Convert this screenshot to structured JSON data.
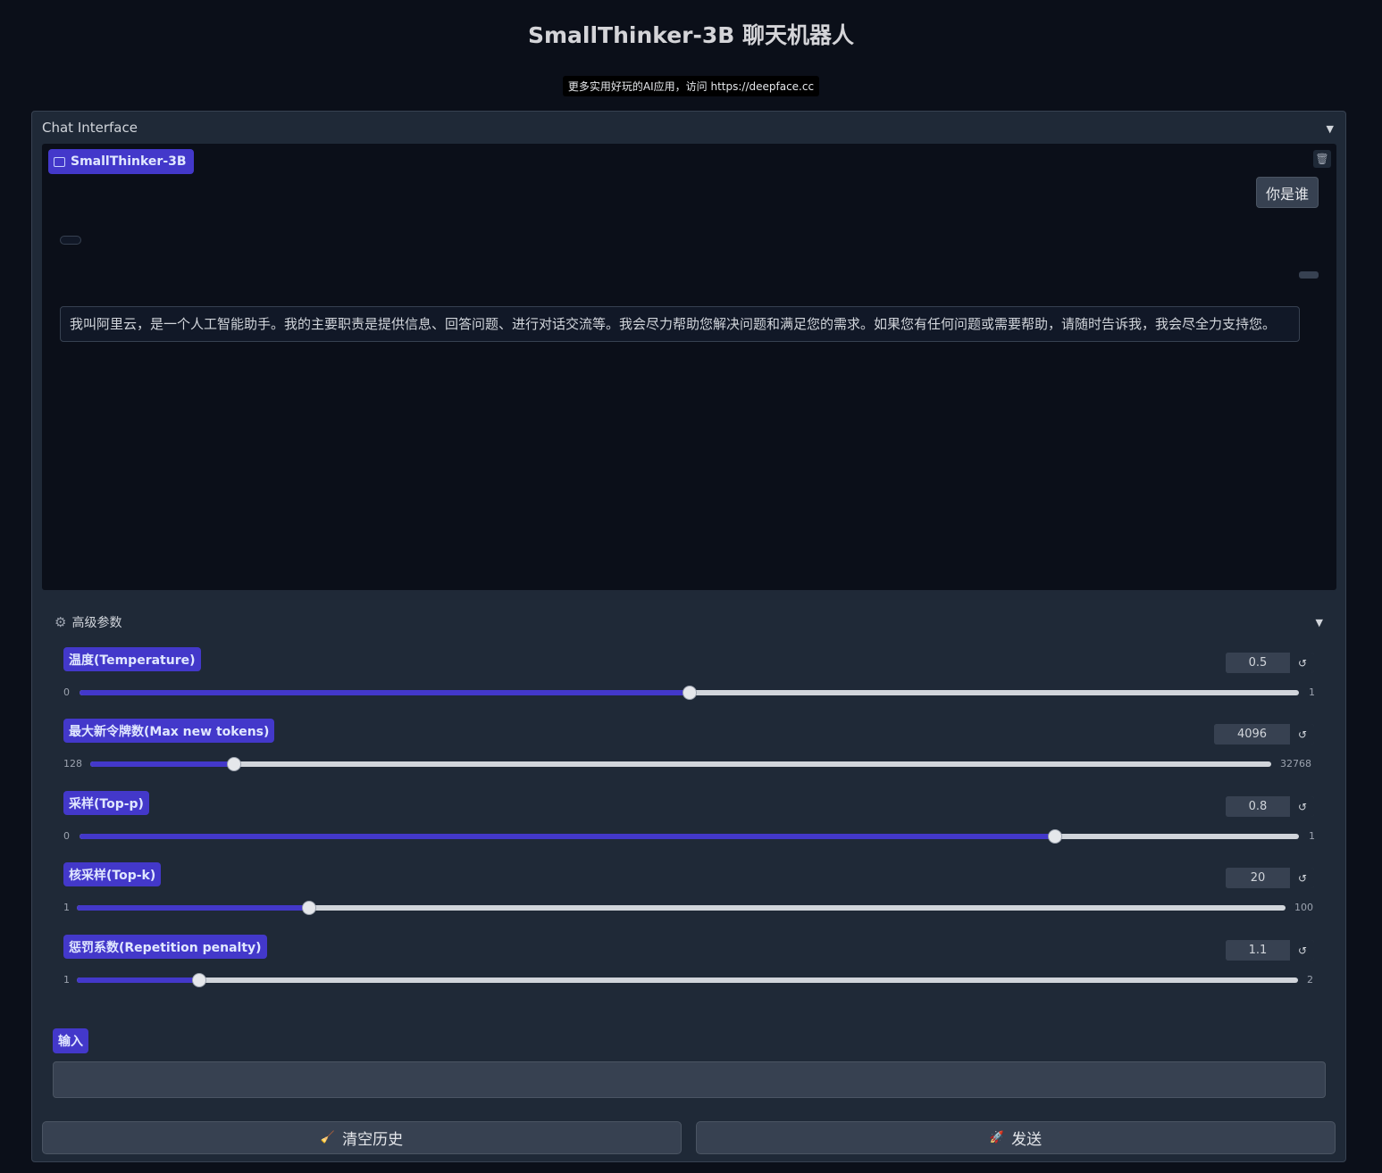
{
  "header": {
    "title": "SmallThinker-3B 聊天机器人",
    "subtitle": "更多实用好玩的AI应用，访问 https://deepface.cc"
  },
  "panel": {
    "title": "Chat Interface",
    "caret": "▼"
  },
  "chatbot": {
    "label": "SmallThinker-3B",
    "trash_icon": "🗑",
    "messages": [
      {
        "role": "user",
        "text": "你是谁"
      },
      {
        "role": "assistant",
        "text": "我叫阿里云，是一个人工智能助手。我的主要职责是提供信息、回答问题、进行对话交流等。我会尽力帮助您解决问题和满足您的需求。如果您有任何问题或需要帮助，请随时告诉我，我会尽全力支持您。"
      }
    ]
  },
  "advanced": {
    "title": "高级参数",
    "gear_icon": "⚙",
    "caret": "▼",
    "reset_icon": "↺",
    "sliders": [
      {
        "label": "温度(Temperature)",
        "value": "0.5",
        "min": "0",
        "max": "1",
        "fraction": 0.5
      },
      {
        "label": "最大新令牌数(Max new tokens)",
        "value": "4096",
        "min": "128",
        "max": "32768",
        "fraction": 0.1216
      },
      {
        "label": "采样(Top-p)",
        "value": "0.8",
        "min": "0",
        "max": "1",
        "fraction": 0.8
      },
      {
        "label": "核采样(Top-k)",
        "value": "20",
        "min": "1",
        "max": "100",
        "fraction": 0.1919
      },
      {
        "label": "惩罚系数(Repetition penalty)",
        "value": "1.1",
        "min": "1",
        "max": "2",
        "fraction": 0.1
      }
    ]
  },
  "input": {
    "label": "输入",
    "value": "",
    "placeholder": ""
  },
  "buttons": {
    "clear_label": "清空历史",
    "clear_icon": "🧹",
    "send_label": "发送",
    "send_icon": "🚀"
  },
  "colors": {
    "accent": "#4338ca",
    "background": "#0b0f19",
    "panel": "#1f2937"
  }
}
